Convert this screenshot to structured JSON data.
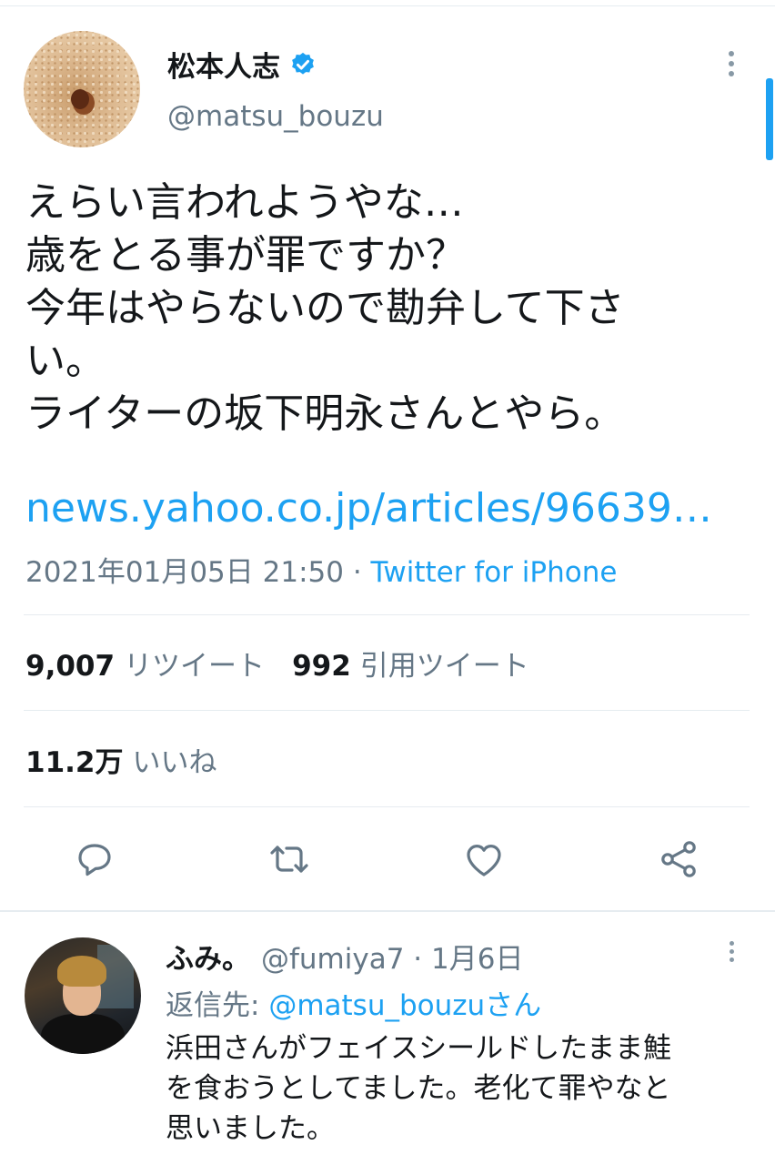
{
  "tweet": {
    "author_name": "松本人志",
    "author_handle": "@matsu_bouzu",
    "text_lines": [
      "えらい言われようやな…",
      "歳をとる事が罪ですか？",
      "今年はやらないので勘弁して下さ",
      "い。",
      "ライターの坂下明永さんとやら。"
    ],
    "link": "news.yahoo.co.jp/articles/96639…",
    "timestamp": "2021年01月05日 21:50",
    "separator": " · ",
    "source": "Twitter for iPhone"
  },
  "stats": {
    "retweets_count": "9,007",
    "retweets_label": "リツイート",
    "quotes_count": "992",
    "quotes_label": "引用ツイート",
    "likes_count": "11.2万",
    "likes_label": "いいね"
  },
  "reply": {
    "name": "ふみ。",
    "handle_date": "@fumiya7 · 1月6日",
    "reply_prefix": "返信先: ",
    "reply_mention": "@matsu_bouzuさん",
    "text_lines": [
      "浜田さんがフェイスシールドしたまま鮭",
      "を食おうとしてました。老化て罪やなと",
      "思いました。"
    ]
  },
  "colors": {
    "accent": "#1da1f2",
    "secondary_text": "#657786",
    "divider": "#e6ecf0"
  },
  "icons": [
    "verified-badge-icon",
    "more-options-icon",
    "reply-icon",
    "retweet-icon",
    "like-icon",
    "share-icon"
  ]
}
